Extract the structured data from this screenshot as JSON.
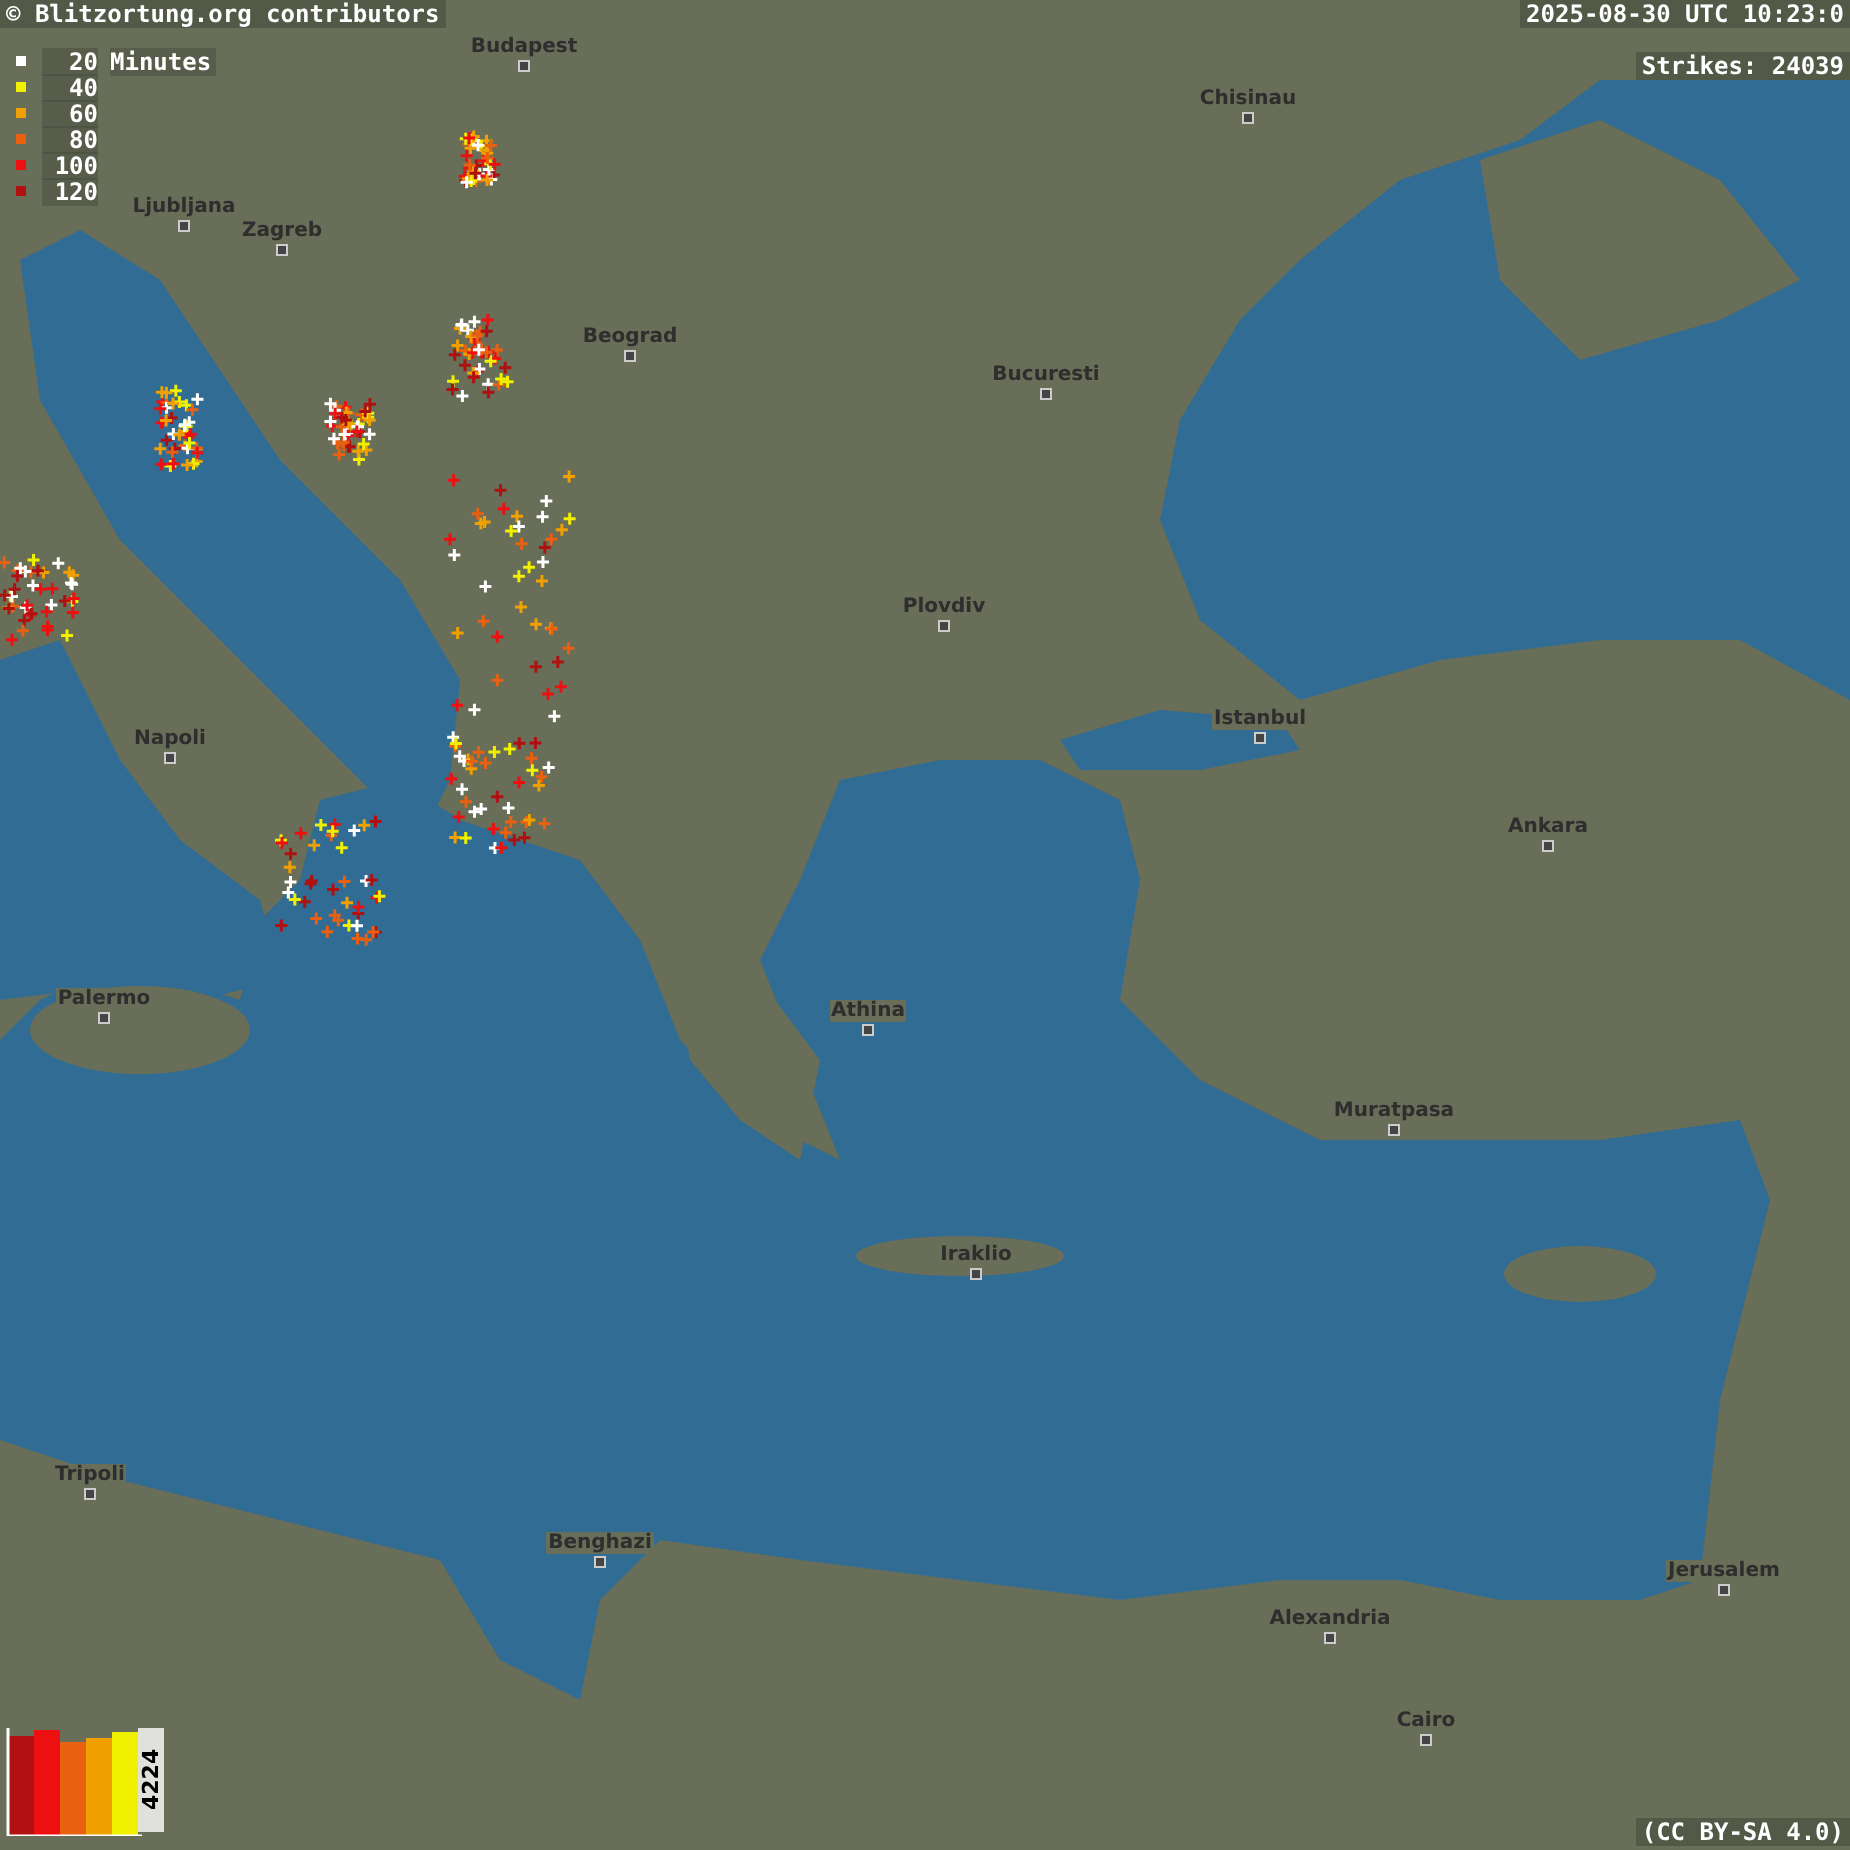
{
  "attribution": "© Blitzortung.org contributors",
  "timestamp": "2025-08-30 UTC 10:23:0",
  "strikes": "Strikes: 24039",
  "legend": {
    "unit": "Minutes",
    "items": [
      {
        "label": "20",
        "color": "#ffffff"
      },
      {
        "label": "40",
        "color": "#f0f000"
      },
      {
        "label": "60",
        "color": "#f0a000"
      },
      {
        "label": "80",
        "color": "#e86010"
      },
      {
        "label": "100",
        "color": "#ee1010"
      },
      {
        "label": "120",
        "color": "#b01010"
      }
    ]
  },
  "cities": [
    "Budapest",
    "Chisinau",
    "Ljubljana",
    "Zagreb",
    "Beograd",
    "Bucuresti",
    "Plovdiv",
    "Istanbul",
    "Napoli",
    "Ankara",
    "Athina",
    "Palermo",
    "Muratpasa",
    "Iraklio",
    "Tripoli",
    "Benghazi",
    "Jerusalem",
    "Alexandria",
    "Cairo"
  ],
  "histogram": {
    "count": "4224"
  },
  "license": "(CC BY-SA 4.0)"
}
